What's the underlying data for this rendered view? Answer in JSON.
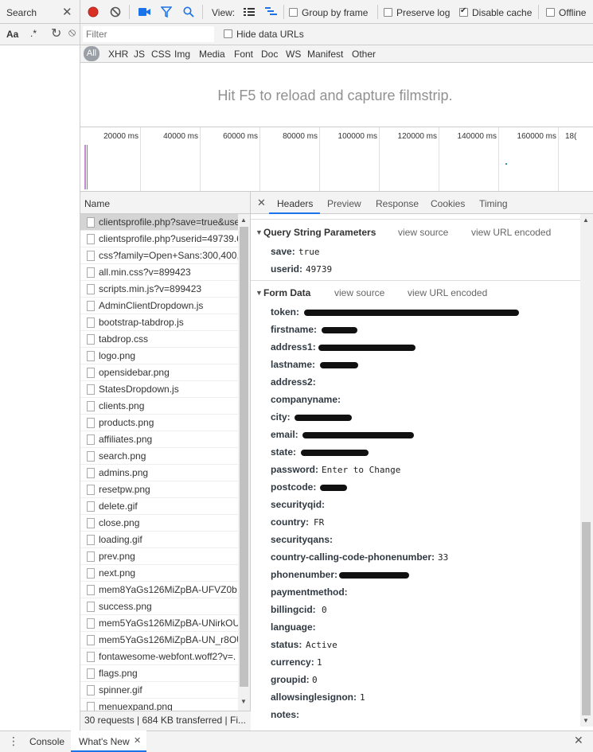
{
  "search_pane": {
    "tab_label": "Search",
    "close_glyph": "✕",
    "aa_label": "Aa",
    "regex_label": ".*",
    "refresh_glyph": "↻",
    "clear_glyph": "⦸"
  },
  "toolbar": {
    "record_color": "#d93025",
    "view_label": "View:",
    "group_by_frame": "Group by frame",
    "preserve_log": "Preserve log",
    "disable_cache": "Disable cache",
    "disable_cache_checked": true,
    "offline": "Offline"
  },
  "filter": {
    "placeholder": "Filter",
    "hide_data_urls": "Hide data URLs",
    "types": [
      "All",
      "XHR",
      "JS",
      "CSS",
      "Img",
      "Media",
      "Font",
      "Doc",
      "WS",
      "Manifest",
      "Other"
    ],
    "active_type": "All"
  },
  "filmstrip": {
    "message": "Hit F5 to reload and capture filmstrip."
  },
  "overview": {
    "ticks": [
      "20000 ms",
      "40000 ms",
      "60000 ms",
      "80000 ms",
      "100000 ms",
      "120000 ms",
      "140000 ms",
      "160000 ms",
      "18("
    ]
  },
  "request_list": {
    "column_name": "Name",
    "rows": [
      {
        "name": "clientsprofile.php?save=true&use",
        "icon": "doc-icon",
        "selected": true
      },
      {
        "name": "clientsprofile.php?userid=49739.6",
        "icon": "doc-icon"
      },
      {
        "name": "css?family=Open+Sans:300,400,6",
        "icon": "doc-icon"
      },
      {
        "name": "all.min.css?v=899423",
        "icon": "doc-icon"
      },
      {
        "name": "scripts.min.js?v=899423",
        "icon": "doc-icon"
      },
      {
        "name": "AdminClientDropdown.js",
        "icon": "doc-icon"
      },
      {
        "name": "bootstrap-tabdrop.js",
        "icon": "doc-icon"
      },
      {
        "name": "tabdrop.css",
        "icon": "doc-icon"
      },
      {
        "name": "logo.png",
        "icon": "doc-icon"
      },
      {
        "name": "opensidebar.png",
        "icon": "bar-image-icon"
      },
      {
        "name": "StatesDropdown.js",
        "icon": "doc-icon"
      },
      {
        "name": "clients.png",
        "icon": "clients-image-icon"
      },
      {
        "name": "products.png",
        "icon": "products-image-icon"
      },
      {
        "name": "affiliates.png",
        "icon": "affiliates-image-icon"
      },
      {
        "name": "search.png",
        "icon": "search-image-icon"
      },
      {
        "name": "admins.png",
        "icon": "admins-image-icon"
      },
      {
        "name": "resetpw.png",
        "icon": "resetpw-image-icon"
      },
      {
        "name": "delete.gif",
        "icon": "delete-image-icon"
      },
      {
        "name": "close.png",
        "icon": "close-image-icon"
      },
      {
        "name": "loading.gif",
        "icon": "loading-image-icon"
      },
      {
        "name": "prev.png",
        "icon": "prev-image-icon"
      },
      {
        "name": "next.png",
        "icon": "next-image-icon"
      },
      {
        "name": "mem8YaGs126MiZpBA-UFVZ0b...",
        "icon": "doc-icon"
      },
      {
        "name": "success.png",
        "icon": "success-image-icon"
      },
      {
        "name": "mem5YaGs126MiZpBA-UNirkOU",
        "icon": "doc-icon"
      },
      {
        "name": "mem5YaGs126MiZpBA-UN_r8OU",
        "icon": "doc-icon"
      },
      {
        "name": "fontawesome-webfont.woff2?v=.",
        "icon": "doc-icon"
      },
      {
        "name": "flags.png",
        "icon": "flags-image-icon"
      },
      {
        "name": "spinner.gif",
        "icon": "spinner-image-icon"
      },
      {
        "name": "menuexpand.png",
        "icon": "doc-icon"
      }
    ],
    "status": "30 requests  |  684 KB transferred  |  Fi..."
  },
  "details": {
    "close_glyph": "✕",
    "tabs": [
      "Headers",
      "Preview",
      "Response",
      "Cookies",
      "Timing"
    ],
    "active_tab": "Headers",
    "query_section": {
      "title": "Query String Parameters",
      "view_source": "view source",
      "view_url_encoded": "view URL encoded",
      "params": [
        {
          "key": "save:",
          "value": "true"
        },
        {
          "key": "userid:",
          "value": "49739"
        }
      ]
    },
    "form_section": {
      "title": "Form Data",
      "view_source": "view source",
      "view_url_encoded": "view URL encoded",
      "fields": [
        {
          "key": "token:",
          "value": "",
          "redacted": true
        },
        {
          "key": "firstname:",
          "value": "",
          "redacted": true
        },
        {
          "key": "address1:",
          "value": "",
          "redacted": true
        },
        {
          "key": "lastname:",
          "value": "",
          "redacted": true
        },
        {
          "key": "address2:",
          "value": ""
        },
        {
          "key": "companyname:",
          "value": ""
        },
        {
          "key": "city:",
          "value": "",
          "redacted": true
        },
        {
          "key": "email:",
          "value": "",
          "redacted": true
        },
        {
          "key": "state:",
          "value": "",
          "redacted": true
        },
        {
          "key": "password:",
          "value": "Enter to Change"
        },
        {
          "key": "postcode:",
          "value": "",
          "redacted": true
        },
        {
          "key": "securityqid:",
          "value": ""
        },
        {
          "key": "country:",
          "value": "FR"
        },
        {
          "key": "securityqans:",
          "value": ""
        },
        {
          "key": "country-calling-code-phonenumber:",
          "value": "33"
        },
        {
          "key": "phonenumber:",
          "value": "",
          "redacted": true
        },
        {
          "key": "paymentmethod:",
          "value": ""
        },
        {
          "key": "billingcid:",
          "value": "0"
        },
        {
          "key": "language:",
          "value": ""
        },
        {
          "key": "status:",
          "value": "Active"
        },
        {
          "key": "currency:",
          "value": "1"
        },
        {
          "key": "groupid:",
          "value": "0"
        },
        {
          "key": "allowsinglesignon:",
          "value": "1"
        },
        {
          "key": "notes:",
          "value": ""
        }
      ]
    }
  },
  "drawer": {
    "menu_glyph": "⋮",
    "tabs": [
      "Console",
      "What's New"
    ],
    "active_tab": "What's New",
    "tab_close_glyph": "✕",
    "close_glyph": "✕"
  }
}
